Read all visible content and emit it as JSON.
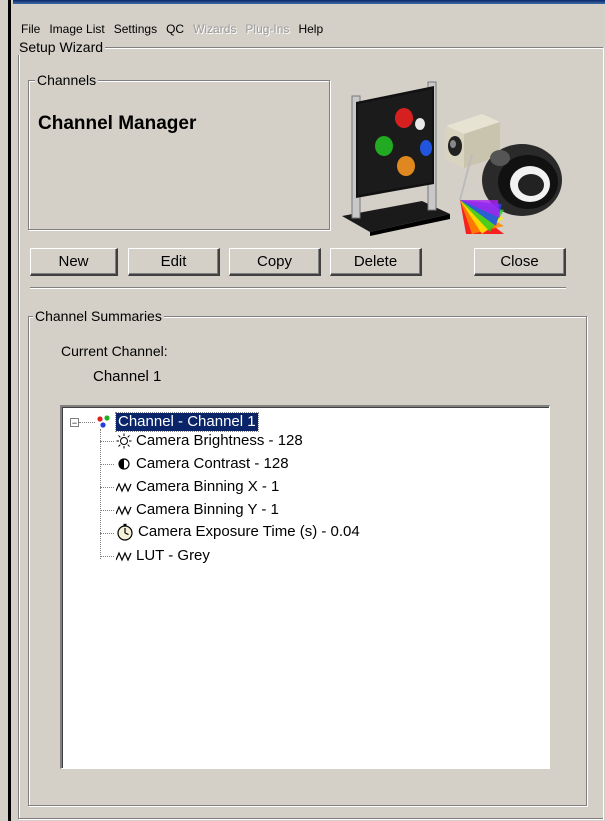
{
  "menu": {
    "items": [
      {
        "label": "File",
        "enabled": true
      },
      {
        "label": "Image List",
        "enabled": true
      },
      {
        "label": "Settings",
        "enabled": true
      },
      {
        "label": "QC",
        "enabled": true
      },
      {
        "label": "Wizards",
        "enabled": false
      },
      {
        "label": "Plug-Ins",
        "enabled": false
      },
      {
        "label": "Help",
        "enabled": true
      }
    ]
  },
  "setup_wizard": {
    "title": "Setup Wizard",
    "channels_group": {
      "title": "Channels",
      "heading": "Channel Manager"
    },
    "buttons": {
      "new": "New",
      "edit": "Edit",
      "copy": "Copy",
      "delete": "Delete",
      "close": "Close"
    },
    "summaries": {
      "title": "Channel Summaries",
      "current_label": "Current Channel:",
      "current_value": "Channel 1",
      "tree": {
        "root": {
          "label": "Channel - Channel 1",
          "icon": "rgb-dots-icon",
          "selected": true
        },
        "children": [
          {
            "label": "Camera Brightness - 128",
            "icon": "brightness-icon"
          },
          {
            "label": "Camera Contrast - 128",
            "icon": "contrast-icon"
          },
          {
            "label": "Camera Binning X - 1",
            "icon": "wave-icon"
          },
          {
            "label": "Camera Binning Y - 1",
            "icon": "wave-icon"
          },
          {
            "label": "Camera Exposure Time (s) - 0.04",
            "icon": "stopwatch-icon"
          },
          {
            "label": "LUT - Grey",
            "icon": "wave-icon"
          }
        ]
      }
    }
  },
  "colors": {
    "window_bg": "#d4d0c8",
    "selection_bg": "#0a246a",
    "disabled_text": "#9a9a9a"
  }
}
